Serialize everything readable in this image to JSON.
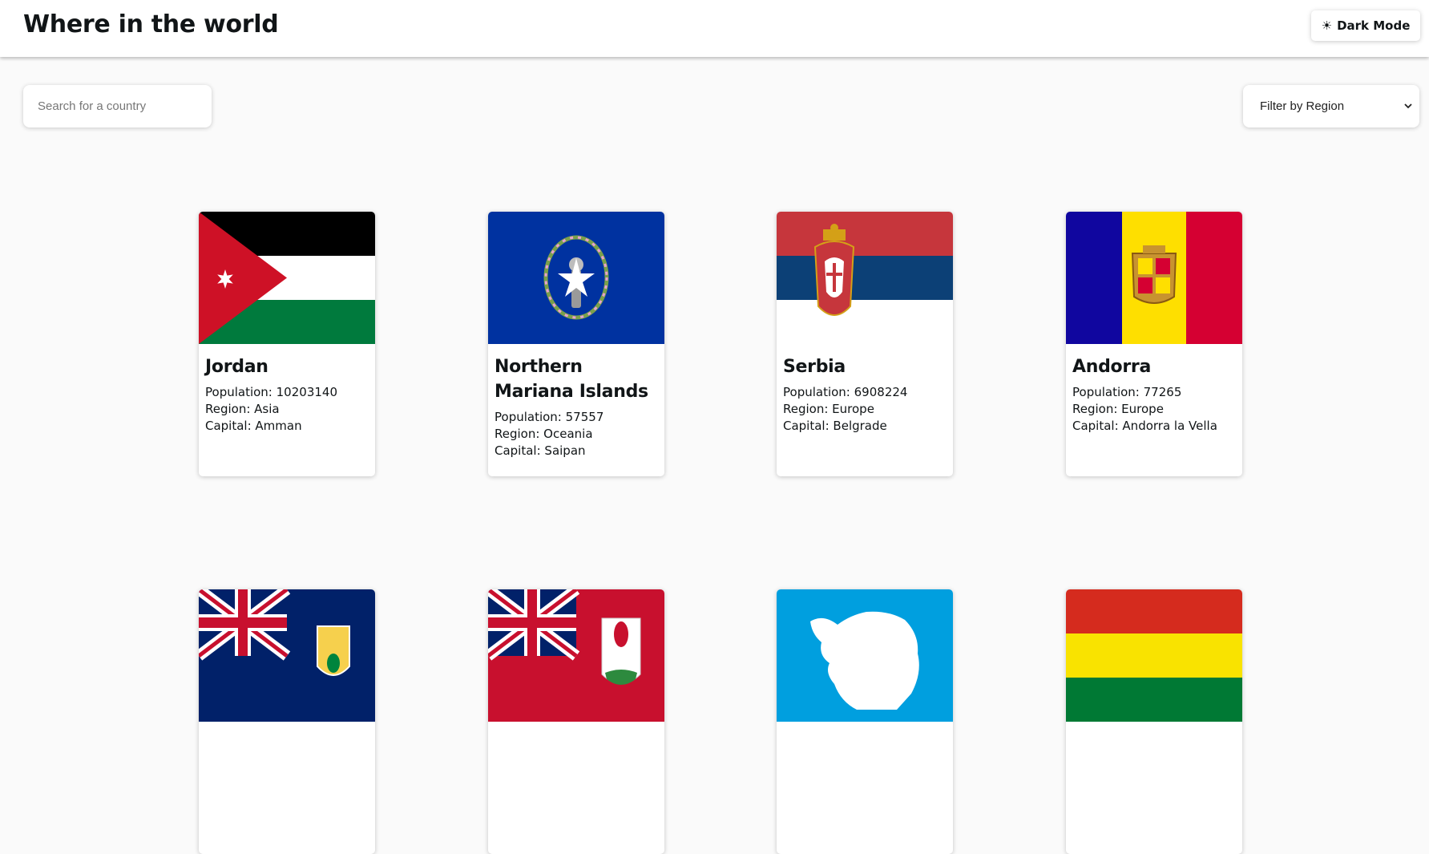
{
  "header": {
    "title": "Where in the world",
    "mode_toggle": {
      "icon": "sun-icon",
      "label": "Dark Mode"
    }
  },
  "search": {
    "placeholder": "Search for a country",
    "value": ""
  },
  "filter": {
    "selected": "Filter by Region",
    "icon": "chevron-down-icon"
  },
  "labels": {
    "population": "Population: ",
    "region": "Region: ",
    "capital": "Capital: "
  },
  "countries": [
    {
      "name": "Jordan",
      "population": "10203140",
      "region": "Asia",
      "capital": "Amman",
      "flag_icon": "flag-jordan-icon"
    },
    {
      "name": "Northern Mariana Islands",
      "population": "57557",
      "region": "Oceania",
      "capital": "Saipan",
      "flag_icon": "flag-northern-mariana-islands-icon"
    },
    {
      "name": "Serbia",
      "population": "6908224",
      "region": "Europe",
      "capital": "Belgrade",
      "flag_icon": "flag-serbia-icon"
    },
    {
      "name": "Andorra",
      "population": "77265",
      "region": "Europe",
      "capital": "Andorra la Vella",
      "flag_icon": "flag-andorra-icon"
    },
    {
      "flag_icon": "flag-turks-and-caicos-icon"
    },
    {
      "flag_icon": "flag-bermuda-icon"
    },
    {
      "flag_icon": "flag-antarctica-icon"
    },
    {
      "flag_icon": "flag-bolivia-icon"
    }
  ]
}
